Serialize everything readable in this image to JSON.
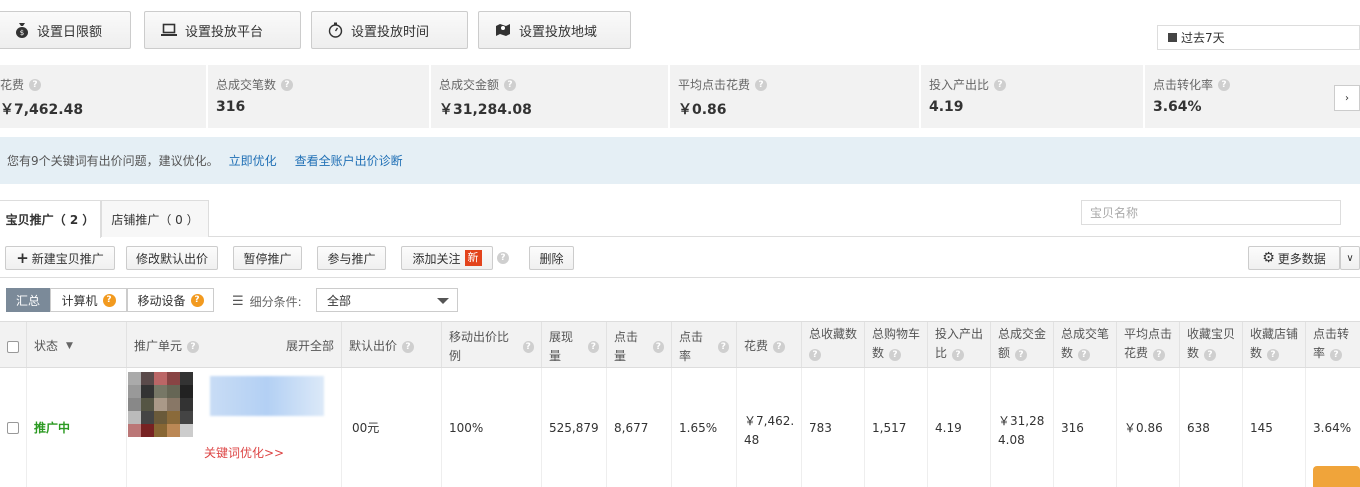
{
  "toolbar": {
    "budget": "设置日限额",
    "platform": "设置投放平台",
    "time": "设置投放时间",
    "region": "设置投放地域",
    "date_range": "过去7天"
  },
  "stats": [
    {
      "label": "花费",
      "value": "￥7,462.48"
    },
    {
      "label": "总成交笔数",
      "value": "316"
    },
    {
      "label": "总成交金额",
      "value": "￥31,284.08"
    },
    {
      "label": "平均点击花费",
      "value": "￥0.86"
    },
    {
      "label": "投入产出比",
      "value": "4.19"
    },
    {
      "label": "点击转化率",
      "value": "3.64%"
    }
  ],
  "notice": {
    "text": "您有9个关键词有出价问题，建议优化。",
    "link1": "立即优化",
    "link2": "查看全账户出价诊断"
  },
  "tabs": {
    "items": "宝贝推广（ 2 ）",
    "shop": "店铺推广（ 0 ）",
    "search_placeholder": "宝贝名称"
  },
  "actions": {
    "new": "新建宝贝推广",
    "modify_bid": "修改默认出价",
    "pause": "暂停推广",
    "join": "参与推广",
    "follow": "添加关注",
    "new_badge": "新",
    "delete": "删除",
    "more_data": "更多数据"
  },
  "filters": {
    "summary": "汇总",
    "computer": "计算机",
    "mobile": "移动设备",
    "condition_label": "细分条件:",
    "condition_value": "全部"
  },
  "columns": {
    "status": "状态",
    "unit": "推广单元",
    "expand": "展开全部",
    "default_bid": "默认出价",
    "mobile_ratio": "移动出价比例",
    "impressions": "展现量",
    "clicks": "点击量",
    "ctr": "点击率",
    "cost": "花费",
    "favorites_l1": "总收藏数",
    "cart_l1": "总购物车",
    "cart_l2": "数",
    "roi_l1": "投入产出",
    "roi_l2": "比",
    "gmv_l1": "总成交金",
    "gmv_l2": "额",
    "orders_l1": "总成交笔",
    "orders_l2": "数",
    "cpc_l1": "平均点击",
    "cpc_l2": "花费",
    "fav_item_l1": "收藏宝贝",
    "fav_item_l2": "数",
    "fav_shop_l1": "收藏店铺",
    "fav_shop_l2": "数",
    "cvr_l1": "点击转",
    "cvr_l2": "率"
  },
  "row": {
    "status": "推广中",
    "keyword_link": "关键词优化>>",
    "default_bid": "00元",
    "mobile_ratio": "100%",
    "impressions": "525,879",
    "clicks": "8,677",
    "ctr": "1.65%",
    "cost_l1": "￥7,462.",
    "cost_l2": "48",
    "favorites": "783",
    "cart": "1,517",
    "roi": "4.19",
    "gmv_l1": "￥31,28",
    "gmv_l2": "4.08",
    "orders": "316",
    "cpc": "￥0.86",
    "fav_item": "638",
    "fav_shop": "145",
    "cvr": "3.64%"
  }
}
